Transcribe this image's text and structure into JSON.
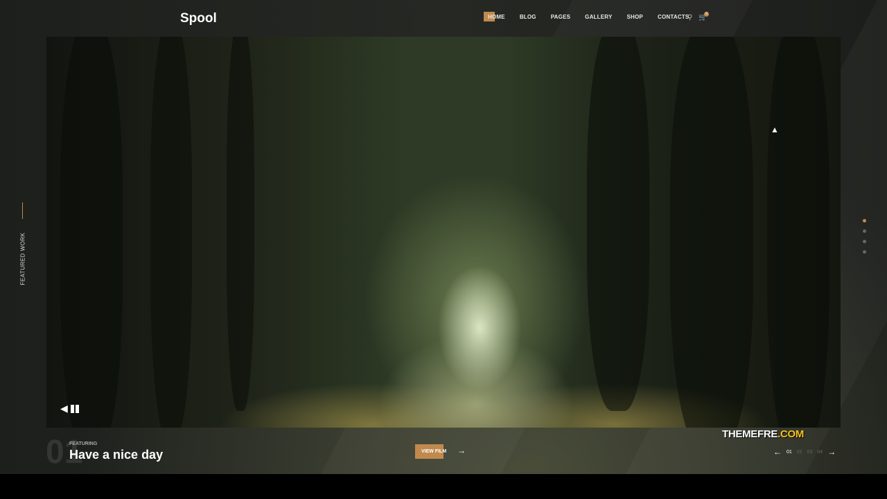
{
  "header": {
    "logo": "Spool",
    "nav": [
      "HOME",
      "BLOG",
      "PAGES",
      "GALLERY",
      "SHOP",
      "CONTACTS"
    ],
    "cart_count": "0",
    "search_icon": "search-icon",
    "cart_icon": "cart-icon"
  },
  "sidebar": {
    "label": "FEATURED WORK"
  },
  "slide": {
    "number": "01",
    "featuring": "FEATURING",
    "title": "Have a nice day",
    "button": "VIEW FILM"
  },
  "pager": {
    "pages": [
      "01",
      "02",
      "03",
      "04"
    ],
    "active": "01"
  },
  "watermark": {
    "main": "THEMEFRE",
    "suffix": ".COM"
  },
  "colors": {
    "accent": "#c08a4e"
  }
}
